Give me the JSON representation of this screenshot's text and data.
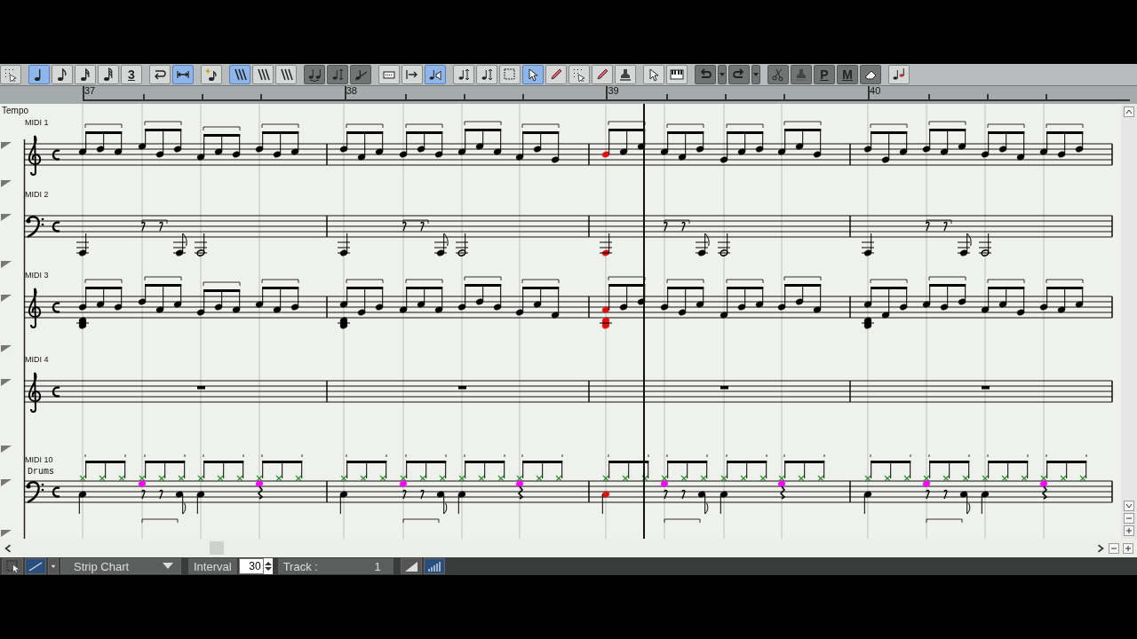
{
  "toolbar": {
    "groups": [
      [
        {
          "kind": "grid",
          "selected": false,
          "disabled": false
        }
      ],
      [
        {
          "kind": "quarter-note",
          "selected": true,
          "disabled": false
        },
        {
          "kind": "eighth-note",
          "selected": false,
          "disabled": false
        },
        {
          "kind": "sixteenth-note",
          "selected": false,
          "disabled": false
        },
        {
          "kind": "thirty-second-note",
          "selected": false,
          "disabled": false
        },
        {
          "kind": "label",
          "label": "3",
          "selected": false,
          "disabled": false
        }
      ],
      [
        {
          "kind": "loop-arrow",
          "selected": false,
          "disabled": false
        },
        {
          "kind": "double-arrow",
          "selected": true,
          "disabled": false
        }
      ],
      [
        {
          "kind": "sparkle-note",
          "selected": false,
          "disabled": false
        }
      ],
      [
        {
          "kind": "slashes",
          "selected": true,
          "disabled": false
        },
        {
          "kind": "slashes",
          "selected": false,
          "disabled": false
        },
        {
          "kind": "slashes",
          "selected": false,
          "disabled": false
        }
      ],
      [
        {
          "kind": "tied-notes",
          "selected": false,
          "disabled": true
        },
        {
          "kind": "stem",
          "selected": false,
          "disabled": true
        },
        {
          "kind": "slur",
          "selected": false,
          "disabled": true
        }
      ],
      [
        {
          "kind": "rectangle",
          "selected": false,
          "disabled": false
        },
        {
          "kind": "arrow-bar",
          "selected": false,
          "disabled": false
        },
        {
          "kind": "note-speaker",
          "selected": true,
          "disabled": false
        }
      ],
      [
        {
          "kind": "stem",
          "selected": false,
          "disabled": false
        },
        {
          "kind": "stem",
          "selected": false,
          "disabled": false
        },
        {
          "kind": "selection",
          "selected": false,
          "disabled": false
        },
        {
          "kind": "pointer",
          "selected": true,
          "disabled": false
        },
        {
          "kind": "pencil",
          "selected": false,
          "disabled": false
        },
        {
          "kind": "grid",
          "selected": false,
          "disabled": false
        },
        {
          "kind": "pencil",
          "selected": false,
          "disabled": false
        },
        {
          "kind": "stamp",
          "selected": false,
          "disabled": false
        }
      ],
      [
        {
          "kind": "pointer",
          "selected": false,
          "disabled": false
        },
        {
          "kind": "piano",
          "selected": false,
          "disabled": false
        }
      ],
      [
        {
          "kind": "undo",
          "selected": false,
          "disabled": true
        },
        {
          "kind": "dropdown",
          "selected": false,
          "disabled": true
        },
        {
          "kind": "redo",
          "selected": false,
          "disabled": true
        },
        {
          "kind": "dropdown",
          "selected": false,
          "disabled": true
        }
      ],
      [
        {
          "kind": "scissors",
          "selected": false,
          "disabled": true
        },
        {
          "kind": "stamp",
          "selected": false,
          "disabled": true
        },
        {
          "kind": "label",
          "label": "P",
          "selected": false,
          "disabled": true
        },
        {
          "kind": "label",
          "label": "M",
          "selected": false,
          "disabled": true
        },
        {
          "kind": "eraser",
          "selected": false,
          "disabled": true
        }
      ],
      [
        {
          "kind": "chords",
          "selected": false,
          "disabled": false
        }
      ]
    ]
  },
  "ruler": {
    "measures": [
      "37",
      "38",
      "39",
      "40"
    ]
  },
  "tempo_label": "Tempo",
  "tracks": [
    {
      "name": "MIDI 1",
      "kind": "melody"
    },
    {
      "name": "MIDI 2",
      "kind": "bass"
    },
    {
      "name": "MIDI 3",
      "kind": "arpeggio"
    },
    {
      "name": "MIDI 4",
      "kind": "rest"
    },
    {
      "name": "MIDI 10",
      "subtitle": "Drums",
      "kind": "drums"
    }
  ],
  "status_bar": {
    "tools": [
      {
        "kind": "selection",
        "selected": false
      },
      {
        "kind": "line",
        "selected": true
      },
      {
        "kind": "dropdown",
        "selected": false
      }
    ],
    "chart_type": "Strip Chart",
    "interval_label": "Interval",
    "interval_value": "30",
    "track_label": "Track :",
    "track_value": "1",
    "view_buttons": [
      {
        "kind": "ramp",
        "selected": false
      },
      {
        "kind": "bars",
        "selected": true
      }
    ]
  }
}
